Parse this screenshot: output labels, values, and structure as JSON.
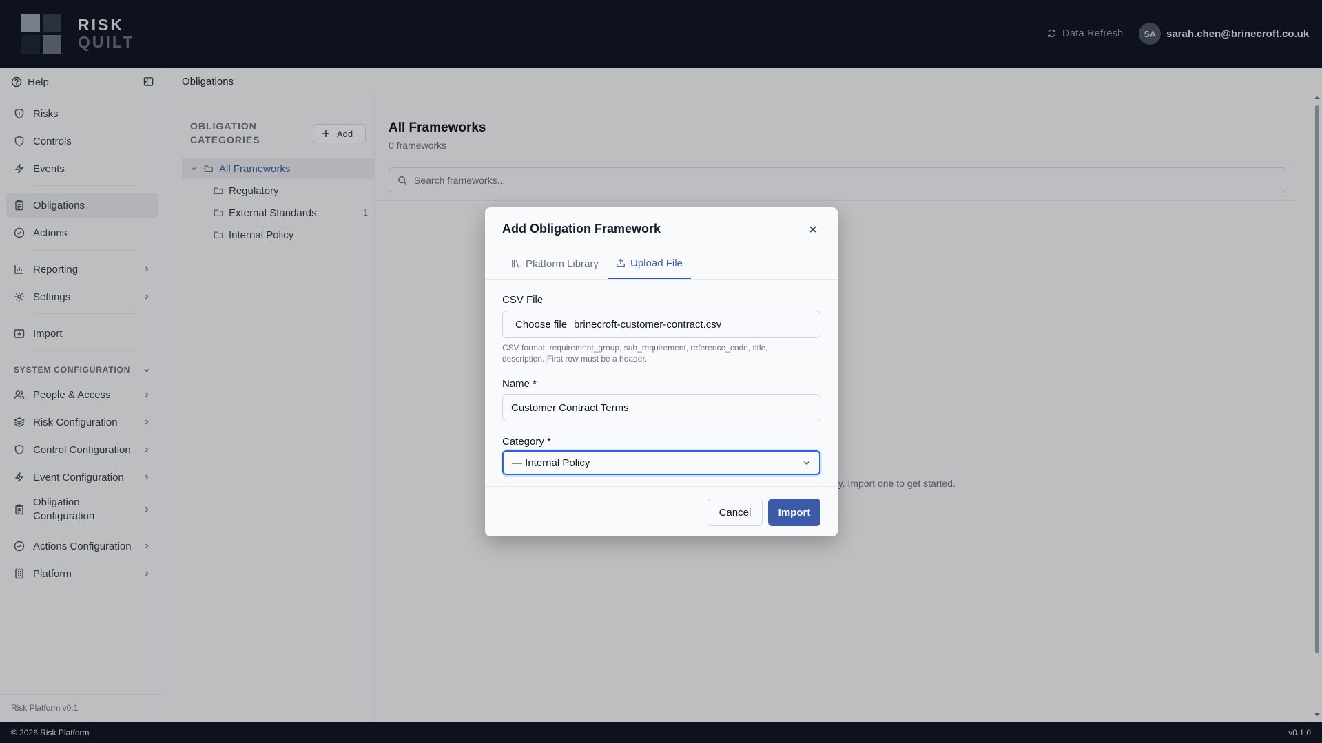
{
  "app": {
    "logo_line1": "RISK",
    "logo_line2": "QUILT",
    "logo_colors": [
      "#9ca3af",
      "#374151",
      "#1f2937",
      "#6b7280"
    ]
  },
  "header": {
    "refresh_label": "Data Refresh",
    "avatar_initials": "SA",
    "user_email": "sarah.chen@brinecroft.co.uk"
  },
  "sidebar": {
    "help": "Help",
    "items": [
      {
        "label": "Risks",
        "icon": "shield-icon"
      },
      {
        "label": "Controls",
        "icon": "shield-outline-icon"
      },
      {
        "label": "Events",
        "icon": "lightning-icon"
      },
      {
        "label": "Obligations",
        "icon": "clipboard-icon",
        "active": true
      },
      {
        "label": "Actions",
        "icon": "check-circle-icon"
      },
      {
        "label": "Reporting",
        "icon": "bar-chart-icon"
      },
      {
        "label": "Settings",
        "icon": "gear-icon"
      },
      {
        "label": "Import",
        "icon": "import-icon"
      }
    ],
    "section_title": "SYSTEM CONFIGURATION",
    "config_items": [
      {
        "label": "People & Access",
        "icon": "people-icon"
      },
      {
        "label": "Risk Configuration",
        "icon": "layers-icon"
      },
      {
        "label": "Control Configuration",
        "icon": "shield-outline-icon"
      },
      {
        "label": "Event Configuration",
        "icon": "lightning-icon"
      },
      {
        "label": "Obligation Configuration",
        "icon": "clipboard-icon"
      },
      {
        "label": "Actions Configuration",
        "icon": "check-circle-icon"
      },
      {
        "label": "Platform",
        "icon": "building-icon"
      }
    ],
    "footer": "Risk Platform v0.1"
  },
  "breadcrumb": "Obligations",
  "categories": {
    "title": "OBLIGATION CATEGORIES",
    "add_label": "Add",
    "tree": [
      {
        "label": "All Frameworks",
        "selected": true
      },
      {
        "label": "Regulatory",
        "count": ""
      },
      {
        "label": "External Standards",
        "count": "1"
      },
      {
        "label": "Internal Policy",
        "count": ""
      }
    ]
  },
  "main": {
    "title": "All Frameworks",
    "subtitle": "0 frameworks",
    "search_placeholder": "Search frameworks...",
    "empty_text": "ry. Import one to get started."
  },
  "modal": {
    "title": "Add Obligation Framework",
    "tabs": [
      {
        "label": "Platform Library",
        "icon": "library-icon"
      },
      {
        "label": "Upload File",
        "icon": "upload-icon",
        "active": true
      }
    ],
    "csv_label": "CSV File",
    "choose_file": "Choose file",
    "file_name": "brinecroft-customer-contract.csv",
    "csv_hint": "CSV format: requirement_group, sub_requirement, reference_code, title, description. First row must be a header.",
    "name_label": "Name *",
    "name_value": "Customer Contract Terms",
    "category_label": "Category *",
    "category_value": "— Internal Policy",
    "cancel": "Cancel",
    "import": "Import",
    "accent": "#3b5ba9"
  },
  "footer": {
    "left": "© 2026 Risk Platform",
    "right": "v0.1.0"
  }
}
